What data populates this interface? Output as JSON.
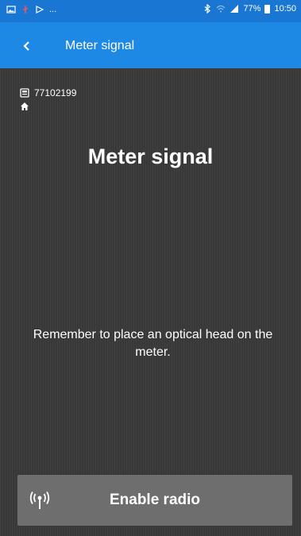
{
  "status_bar": {
    "notifications": [
      "image-icon",
      "usb-icon",
      "play-icon"
    ],
    "overflow_text": "...",
    "bluetooth_icon": "bluetooth-icon",
    "battery_percent": "77%",
    "time": "10:50"
  },
  "app_bar": {
    "title": "Meter signal",
    "back_icon": "chevron-left-icon"
  },
  "content": {
    "meter_id": "77102199",
    "heading": "Meter signal",
    "instruction": "Remember to place an optical head on the meter.",
    "enable_button_label": "Enable radio"
  },
  "colors": {
    "status_bar": "#1976d2",
    "app_bar": "#1e88e5",
    "background": "#383838",
    "button": "#6e6e6e"
  }
}
